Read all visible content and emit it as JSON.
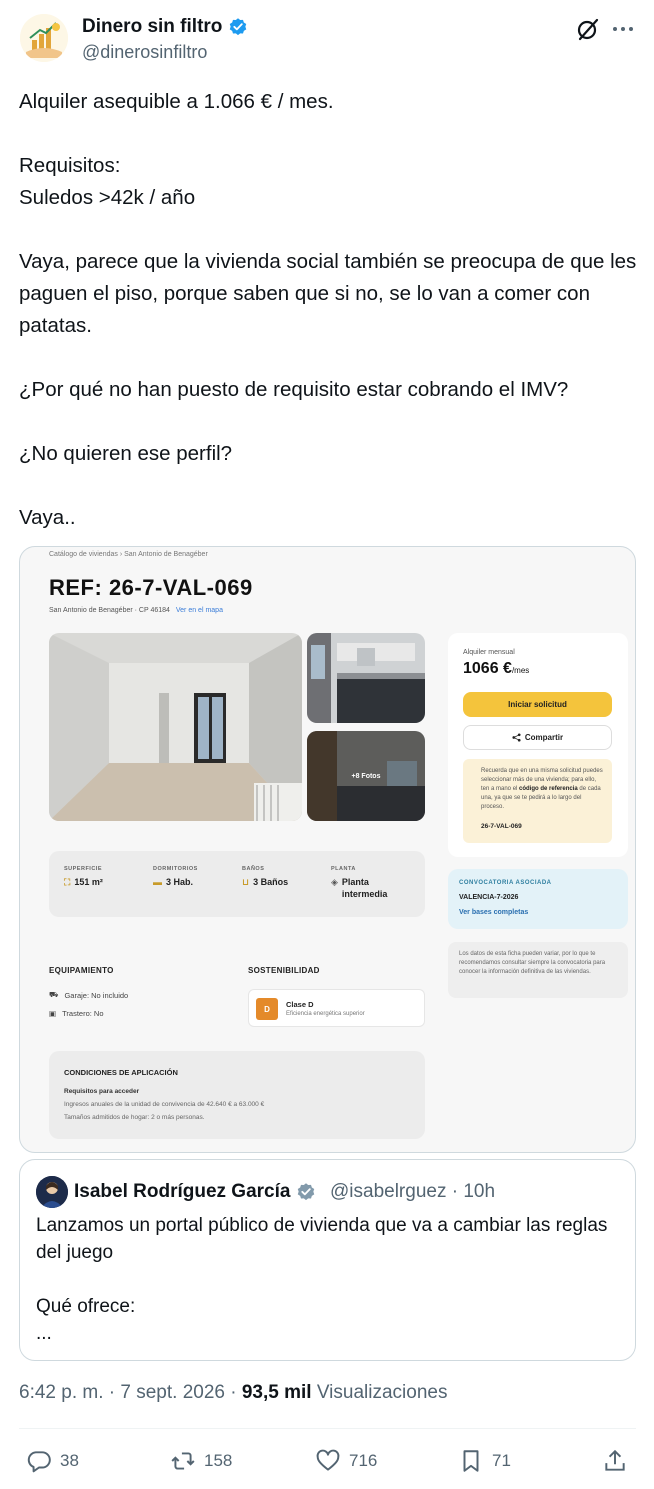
{
  "author": {
    "name": "Dinero sin filtro",
    "handle": "@dinerosinfiltro"
  },
  "tweet": {
    "paragraphs": [
      "Alquiler asequible a 1.066 € / mes.",
      "",
      "Requisitos:",
      "Suledos >42k / año",
      "",
      "Vaya, parece que la vivienda social también se preocupa de que les paguen el piso, porque saben que si no, se lo van a comer con patatas.",
      "",
      "¿Por qué no han puesto de requisito estar cobrando el IMV?",
      "",
      "¿No quieren ese perfil?",
      "",
      "Vaya.."
    ]
  },
  "listing": {
    "breadcrumb": "Catálogo de viviendas › San Antonio de Benagéber",
    "ref": "REF: 26-7-VAL-069",
    "location": "San Antonio de Benagéber · CP 46184",
    "map_link": "Ver en el mapa",
    "photos_label": "+8 Fotos",
    "rent_label": "Alquiler mensual",
    "rent_value": "1066 €",
    "rent_unit": "/mes",
    "apply_label": "Iniciar solicitud",
    "share_label": "Compartir",
    "notice_pre": "Recuerda que en una misma solicitud puedes seleccionar más de una vivienda; para ello, ten a mano el",
    "notice_bold": "código de referencia",
    "notice_post": "de cada una, ya que se te pedirá a lo largo del proceso.",
    "notice_ref": "26-7-VAL-069",
    "conv_title": "CONVOCATORIA ASOCIADA",
    "conv_code": "VALENCIA-7-2026",
    "conv_link": "Ver bases completas",
    "disclaimer": "Los datos de esta ficha pueden variar, por lo que te recomendamos consultar siempre la convocatoria para conocer la información definitiva de las viviendas.",
    "stats": [
      {
        "head": "SUPERFICIE",
        "value": "151 m²",
        "icon": "area-icon"
      },
      {
        "head": "DORMITORIOS",
        "value": "3 Hab.",
        "icon": "bed-icon"
      },
      {
        "head": "BAÑOS",
        "value": "3 Baños",
        "icon": "bath-icon"
      },
      {
        "head": "PLANTA",
        "value": "Planta intermedia",
        "icon": "layers-icon"
      }
    ],
    "equip_title": "EQUIPAMIENTO",
    "equip_items": [
      "Garaje: No incluido",
      "Trastero: No"
    ],
    "sost_title": "SOSTENIBILIDAD",
    "sost_badge": "D",
    "sost_class": "Clase D",
    "sost_desc": "Eficiencia energética superior",
    "cond_title": "CONDICIONES DE APLICACIÓN",
    "cond_sub": "Requisitos para acceder",
    "cond_line1": "Ingresos anuales de la unidad de convivencia de 42.640 € a 63.000 €",
    "cond_line2": "Tamaños admitidos de hogar: 2 o más personas."
  },
  "quoted": {
    "name": "Isabel Rodríguez García",
    "handle": "@isabelrguez · 10h",
    "paragraphs": [
      "Lanzamos un portal público de vivienda que va a cambiar las reglas del juego",
      "",
      "Qué ofrece:",
      "..."
    ]
  },
  "meta": {
    "time": "6:42 p. m. · 7 sept. 2026 · ",
    "views_count": "93,5 mil",
    "views_label": " Visualizaciones"
  },
  "actions": {
    "replies": "38",
    "reposts": "158",
    "likes": "716",
    "bookmarks": "71"
  },
  "colors": {
    "verified": "#1d9bf0",
    "text": "#0f1419",
    "secondary": "#536471",
    "apply_button": "#f4c43c"
  }
}
